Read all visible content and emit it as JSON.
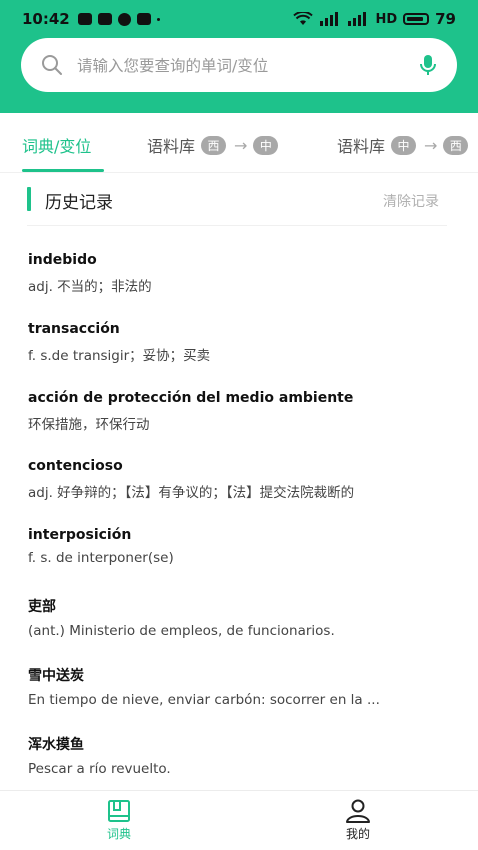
{
  "status_bar": {
    "time": "10:42",
    "network": "HD",
    "battery": "79"
  },
  "search": {
    "placeholder": "请输入您要查询的单词/变位"
  },
  "tabs": [
    {
      "label": "词典/变位"
    },
    {
      "label": "语料库",
      "from": "西",
      "to": "中"
    },
    {
      "label": "语料库",
      "from": "中",
      "to": "西"
    }
  ],
  "history": {
    "title": "历史记录",
    "clear_label": "清除记录",
    "items": [
      {
        "word": "indebido",
        "definition": "adj. 不当的；非法的"
      },
      {
        "word": "transacción",
        "definition": "f. s.de transigir；妥协；买卖"
      },
      {
        "word": "acción de protección del medio ambiente",
        "definition": "环保措施，环保行动"
      },
      {
        "word": "contencioso",
        "definition": "adj. 好争辩的；【法】有争议的；【法】提交法院裁断的"
      },
      {
        "word": "interposición",
        "definition": "f. s. de interponer(se)"
      },
      {
        "word": "吏部",
        "definition": "(ant.) Ministerio de empleos, de funcionarios."
      },
      {
        "word": "雪中送炭",
        "definition": "En tiempo de nieve, enviar carbón: socorrer en la ..."
      },
      {
        "word": "浑水摸鱼",
        "definition": "Pescar a río revuelto."
      }
    ]
  },
  "bottom_nav": [
    {
      "label": "词典",
      "icon": "dictionary-icon"
    },
    {
      "label": "我的",
      "icon": "user-icon"
    }
  ],
  "colors": {
    "accent": "#1ec28b",
    "muted": "#a8a8a8"
  }
}
